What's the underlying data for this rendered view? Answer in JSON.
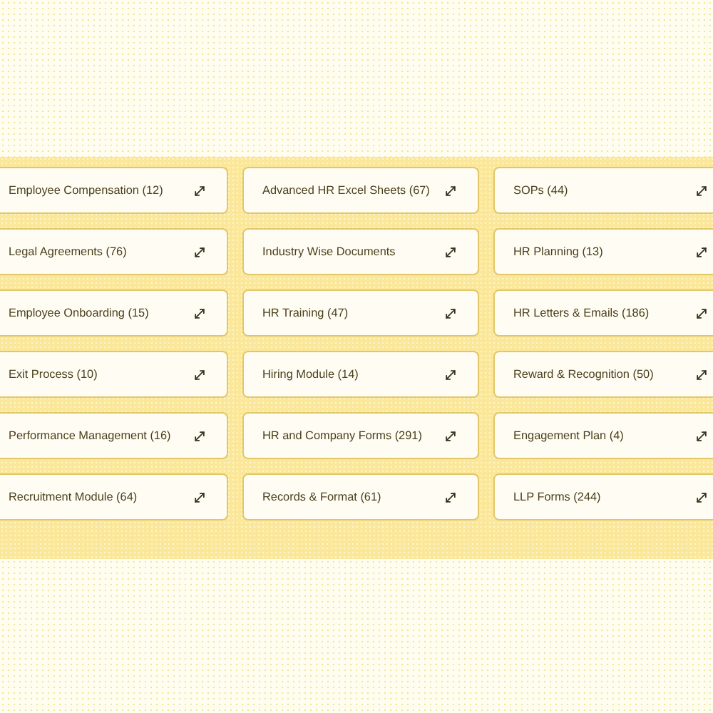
{
  "categories": [
    {
      "label": "Employee Compensation (12)"
    },
    {
      "label": "Advanced HR Excel Sheets (67)"
    },
    {
      "label": "SOPs (44)"
    },
    {
      "label": "Legal Agreements (76)"
    },
    {
      "label": "Industry Wise Documents"
    },
    {
      "label": "HR Planning (13)"
    },
    {
      "label": "Employee Onboarding (15)"
    },
    {
      "label": "HR Training (47)"
    },
    {
      "label": "HR Letters & Emails (186)"
    },
    {
      "label": "Exit Process (10)"
    },
    {
      "label": "Hiring Module (14)"
    },
    {
      "label": "Reward & Recognition (50)"
    },
    {
      "label": "Performance Management (16)"
    },
    {
      "label": "HR and Company Forms (291)"
    },
    {
      "label": "Engagement Plan (4)"
    },
    {
      "label": "Recruitment Module (64)"
    },
    {
      "label": "Records & Format (61)"
    },
    {
      "label": "LLP Forms (244)"
    }
  ]
}
